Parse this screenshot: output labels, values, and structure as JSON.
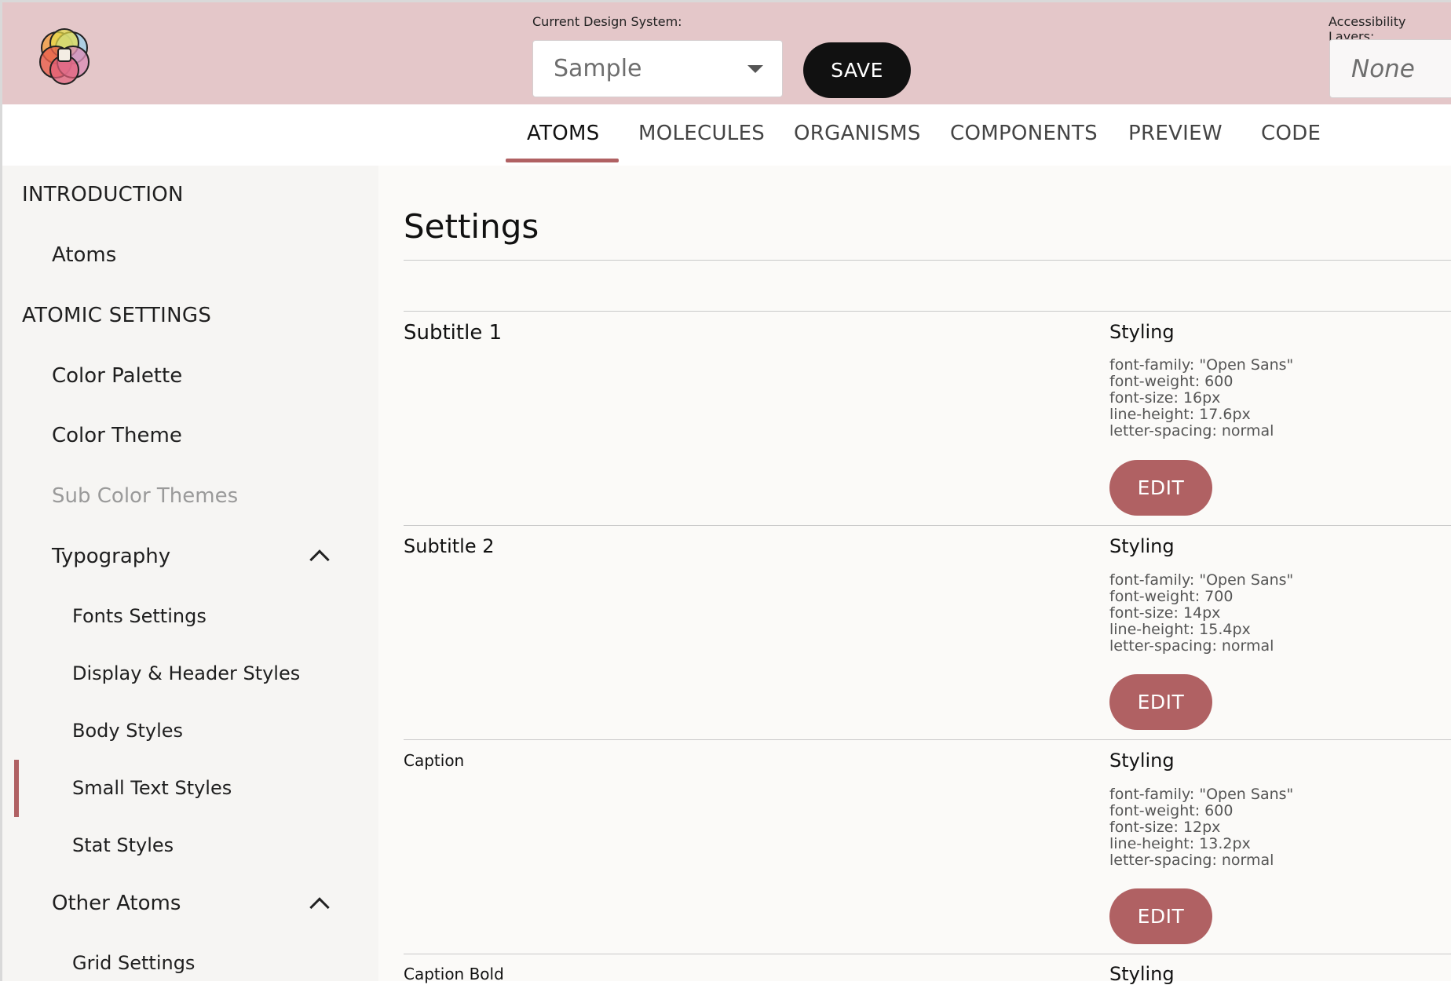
{
  "header": {
    "design_system_label": "Current Design System:",
    "design_system_value": "Sample",
    "save_label": "SAVE",
    "accessibility_label": "Accessibility Layers:",
    "accessibility_value": "None",
    "accent_color": "#b06163",
    "bar_color": "#e4c7c9"
  },
  "tabs": [
    {
      "label": "ATOMS",
      "active": true
    },
    {
      "label": "MOLECULES"
    },
    {
      "label": "ORGANISMS"
    },
    {
      "label": "COMPONENTS"
    },
    {
      "label": "PREVIEW"
    },
    {
      "label": "CODE"
    }
  ],
  "sidebar": {
    "items": [
      {
        "label": "INTRODUCTION"
      },
      {
        "label": "Atoms"
      },
      {
        "label": "ATOMIC SETTINGS"
      },
      {
        "label": "Color Palette"
      },
      {
        "label": "Color Theme"
      },
      {
        "label": "Sub Color Themes"
      },
      {
        "label": "Typography"
      },
      {
        "label": "Fonts Settings"
      },
      {
        "label": "Display & Header Styles"
      },
      {
        "label": "Body Styles"
      },
      {
        "label": "Small Text Styles",
        "active": true
      },
      {
        "label": "Stat Styles"
      },
      {
        "label": "Other Atoms"
      },
      {
        "label": "Grid Settings"
      }
    ]
  },
  "main": {
    "title": "Settings",
    "rows": [
      {
        "title": "Subtitle 1",
        "styling_label": "Styling",
        "specs": [
          "font-family: \"Open Sans\"",
          "font-weight: 600",
          "font-size: 16px",
          "line-height: 17.6px",
          "letter-spacing: normal"
        ],
        "edit_label": "EDIT"
      },
      {
        "title": "Subtitle 2",
        "styling_label": "Styling",
        "specs": [
          "font-family: \"Open Sans\"",
          "font-weight: 700",
          "font-size: 14px",
          "line-height: 15.4px",
          "letter-spacing: normal"
        ],
        "edit_label": "EDIT"
      },
      {
        "title": "Caption",
        "styling_label": "Styling",
        "specs": [
          "font-family: \"Open Sans\"",
          "font-weight: 600",
          "font-size: 12px",
          "line-height: 13.2px",
          "letter-spacing: normal"
        ],
        "edit_label": "EDIT"
      },
      {
        "title": "Caption Bold",
        "styling_label": "Styling"
      }
    ]
  }
}
